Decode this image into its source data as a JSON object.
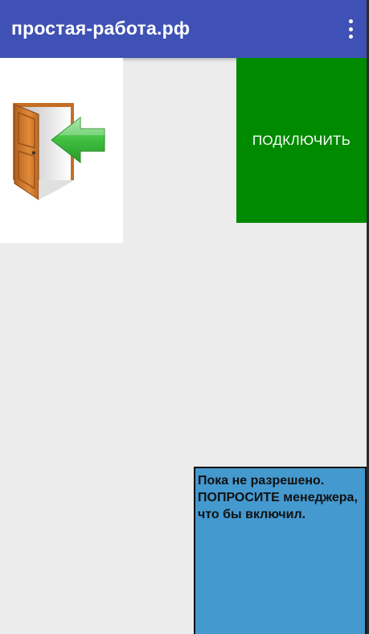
{
  "app_bar": {
    "title": "простая-работа.рф",
    "menu_icon": "more-vert-icon",
    "background": "#3f51b5"
  },
  "exit_card": {
    "icon": "door-enter-icon"
  },
  "connect_button": {
    "label": "ПОДКЛЮЧИТЬ",
    "background": "#008a00"
  },
  "status_box": {
    "text": "Пока не разрешено.\nПОПРОСИТЕ менеджера, что бы включил.",
    "background": "#4499cf"
  }
}
